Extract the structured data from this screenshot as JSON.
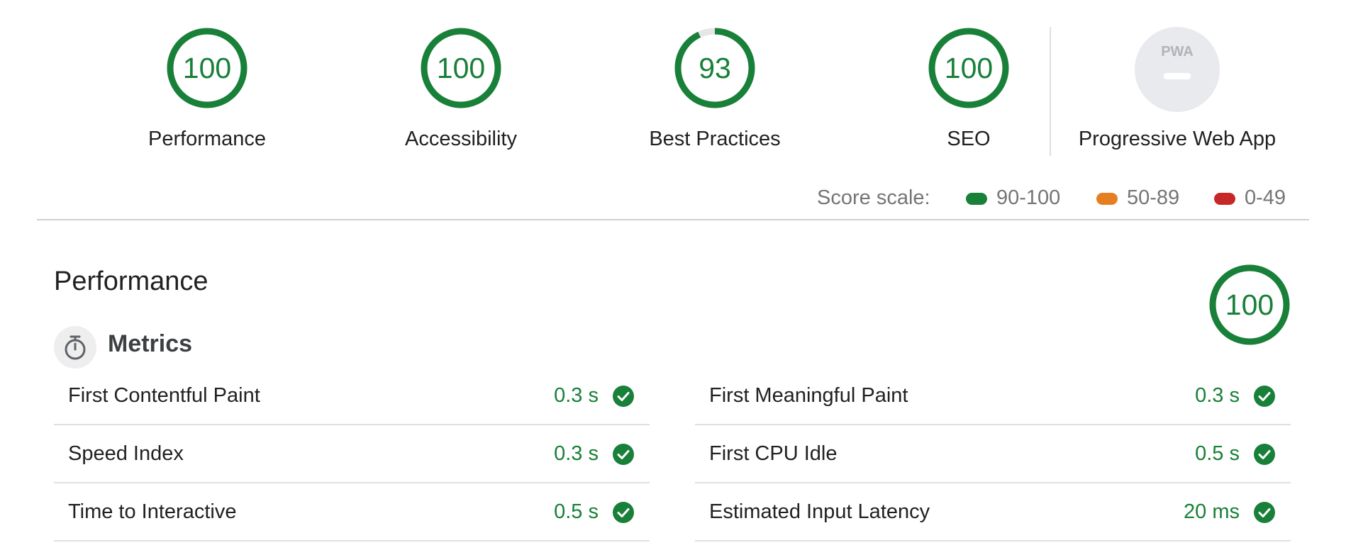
{
  "categories": [
    {
      "label": "Performance",
      "score": "100",
      "fraction": 1.0
    },
    {
      "label": "Accessibility",
      "score": "100",
      "fraction": 1.0
    },
    {
      "label": "Best Practices",
      "score": "93",
      "fraction": 0.93
    },
    {
      "label": "SEO",
      "score": "100",
      "fraction": 1.0
    }
  ],
  "pwa": {
    "label": "Progressive Web App",
    "badge_text": "PWA"
  },
  "score_scale": {
    "label": "Score scale:",
    "ranges": [
      {
        "text": "90-100",
        "color": "#188038"
      },
      {
        "text": "50-89",
        "color": "#e67e22"
      },
      {
        "text": "0-49",
        "color": "#c62828"
      }
    ]
  },
  "performance_section": {
    "title": "Performance",
    "score": "100",
    "fraction": 1.0
  },
  "metrics": {
    "heading": "Metrics",
    "left": [
      {
        "label": "First Contentful Paint",
        "value": "0.3 s"
      },
      {
        "label": "Speed Index",
        "value": "0.3 s"
      },
      {
        "label": "Time to Interactive",
        "value": "0.5 s"
      }
    ],
    "right": [
      {
        "label": "First Meaningful Paint",
        "value": "0.3 s"
      },
      {
        "label": "First CPU Idle",
        "value": "0.5 s"
      },
      {
        "label": "Estimated Input Latency",
        "value": "20 ms"
      }
    ]
  },
  "colors": {
    "pass": "#188038",
    "track": "#e6e6e6"
  }
}
